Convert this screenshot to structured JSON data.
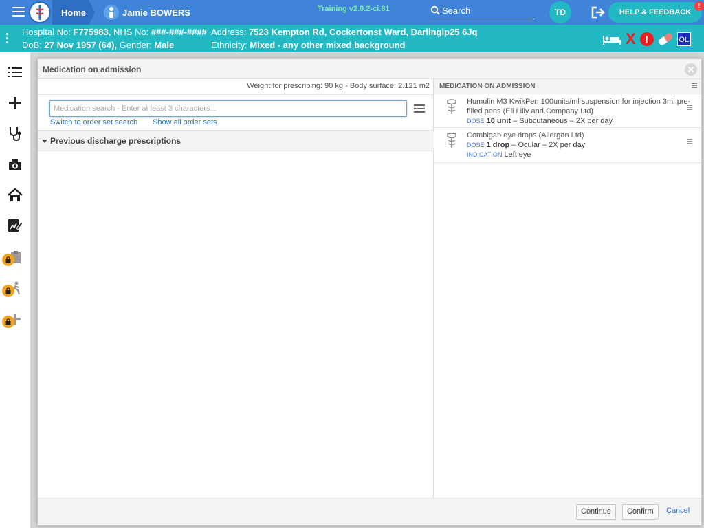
{
  "topbar": {
    "home_label": "Home",
    "patient_name": "Jamie BOWERS",
    "version": "Training v2.0.2-ci.81",
    "search_label": "Search",
    "user_initials": "TD",
    "help_label": "HELP & FEEDBACK",
    "help_badge": "!"
  },
  "patient": {
    "hospital_no_label": "Hospital No:",
    "hospital_no": "F775983,",
    "nhs_no_label": "NHS No:",
    "nhs_no": "###-###-####",
    "address_label": "Address:",
    "address": "7523 Kempton Rd, Cockertonst Ward, Darlingip25 6Jq",
    "dob_label": "DoB:",
    "dob": "27 Nov 1957 (64),",
    "gender_label": "Gender:",
    "gender": "Male",
    "ethnicity_label": "Ethnicity:",
    "ethnicity": "Mixed - any other mixed background",
    "status_icons": [
      "bed-icon",
      "x-icon",
      "alert-icon",
      "pill-icon",
      "ol-badge"
    ],
    "x_mark": "X",
    "alert_mark": "!",
    "ol_label": "OL"
  },
  "sidenav": [
    "list-icon",
    "plus-icon",
    "stethoscope-icon",
    "camera-icon",
    "house-icon",
    "chart-edit-icon",
    "locked-clipboard-icon",
    "locked-person-icon",
    "locked-plus-icon"
  ],
  "modal": {
    "title": "Medication on admission",
    "weight_text": "Weight for prescribing: 90 kg - Body surface: 2.121 m2",
    "search_placeholder": "Medication search - Enter at least 3 characters...",
    "link_order_set": "Switch to order set search",
    "link_show_all": "Show all order sets",
    "prev_discharge": "Previous discharge prescriptions",
    "right_header": "MEDICATION ON ADMISSION",
    "meds": [
      {
        "name": "Humulin M3 KwikPen 100units/ml suspension for injection 3ml pre-filled pens (Eli Lilly and Company Ltd)",
        "dose_label": "DOSE",
        "dose": "10 unit",
        "route": "– Subcutaneous – 2X per day"
      },
      {
        "name": "Combigan eye drops (Allergan Ltd)",
        "dose_label": "DOSE",
        "dose": "1 drop",
        "route": "– Ocular – 2X per day",
        "indication_label": "INDICATION",
        "indication": "Left eye"
      }
    ],
    "btn_continue": "Continue",
    "btn_confirm": "Confirm",
    "btn_cancel": "Cancel"
  }
}
